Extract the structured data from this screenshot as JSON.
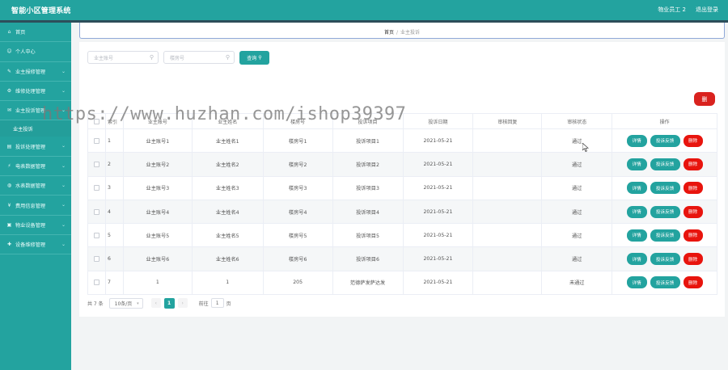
{
  "app": {
    "title": "智能小区管理系统",
    "user": "物业员工 2",
    "logout": "退出登录"
  },
  "sidebar": {
    "items": [
      {
        "label": "首页",
        "icon": "home-icon"
      },
      {
        "label": "个人中心",
        "icon": "user-icon"
      },
      {
        "label": "业主报修管理",
        "icon": "wrench-icon"
      },
      {
        "label": "维修处理管理",
        "icon": "gear-icon"
      },
      {
        "label": "业主投诉管理",
        "icon": "message-icon"
      },
      {
        "label": "投诉处理管理",
        "icon": "clipboard-icon"
      },
      {
        "label": "电表数据管理",
        "icon": "bolt-icon"
      },
      {
        "label": "水表数据管理",
        "icon": "drop-icon"
      },
      {
        "label": "费用信息管理",
        "icon": "money-icon"
      },
      {
        "label": "物业设备管理",
        "icon": "device-icon"
      },
      {
        "label": "设备维修管理",
        "icon": "tool-icon"
      }
    ],
    "sub_item": "业主投诉"
  },
  "breadcrumb": {
    "home": "首页",
    "sep": "/",
    "current": "业主投诉"
  },
  "search": {
    "owner_placeholder": "业主账号",
    "building_placeholder": "楼房号",
    "query_label": "查询"
  },
  "delete_top_label": "删",
  "table": {
    "headers": [
      "索引",
      "业主账号",
      "业主姓名",
      "楼房号",
      "投诉项目",
      "投诉日期",
      "审核回复",
      "审核状态",
      "操作"
    ],
    "rows": [
      {
        "idx": "1",
        "account": "业主账号1",
        "name": "业主姓名1",
        "building": "楼房号1",
        "item": "投诉项目1",
        "date": "2021-05-21",
        "reply": "",
        "status": "通过"
      },
      {
        "idx": "2",
        "account": "业主账号2",
        "name": "业主姓名2",
        "building": "楼房号2",
        "item": "投诉项目2",
        "date": "2021-05-21",
        "reply": "",
        "status": "通过"
      },
      {
        "idx": "3",
        "account": "业主账号3",
        "name": "业主姓名3",
        "building": "楼房号3",
        "item": "投诉项目3",
        "date": "2021-05-21",
        "reply": "",
        "status": "通过"
      },
      {
        "idx": "4",
        "account": "业主账号4",
        "name": "业主姓名4",
        "building": "楼房号4",
        "item": "投诉项目4",
        "date": "2021-05-21",
        "reply": "",
        "status": "通过"
      },
      {
        "idx": "5",
        "account": "业主账号5",
        "name": "业主姓名5",
        "building": "楼房号5",
        "item": "投诉项目5",
        "date": "2021-05-21",
        "reply": "",
        "status": "通过"
      },
      {
        "idx": "6",
        "account": "业主账号6",
        "name": "业主姓名6",
        "building": "楼房号6",
        "item": "投诉项目6",
        "date": "2021-05-21",
        "reply": "",
        "status": "通过"
      },
      {
        "idx": "7",
        "account": "1",
        "name": "1",
        "building": "205",
        "item": "范德萨发萨达发",
        "date": "2021-05-21",
        "reply": "",
        "status": "未通过"
      }
    ],
    "actions": {
      "detail": "详情",
      "feedback": "投诉反馈",
      "delete": "删除"
    }
  },
  "pagination": {
    "total": "共 7 条",
    "page_size": "10条/页",
    "current_page": "1",
    "goto_label": "前往",
    "goto_value": "1",
    "page_unit": "页"
  },
  "watermark": "https://www.huzhan.com/ishop39397",
  "colors": {
    "primary": "#23a39f",
    "danger": "#e8140d",
    "header_line": "#2d4e5a"
  }
}
